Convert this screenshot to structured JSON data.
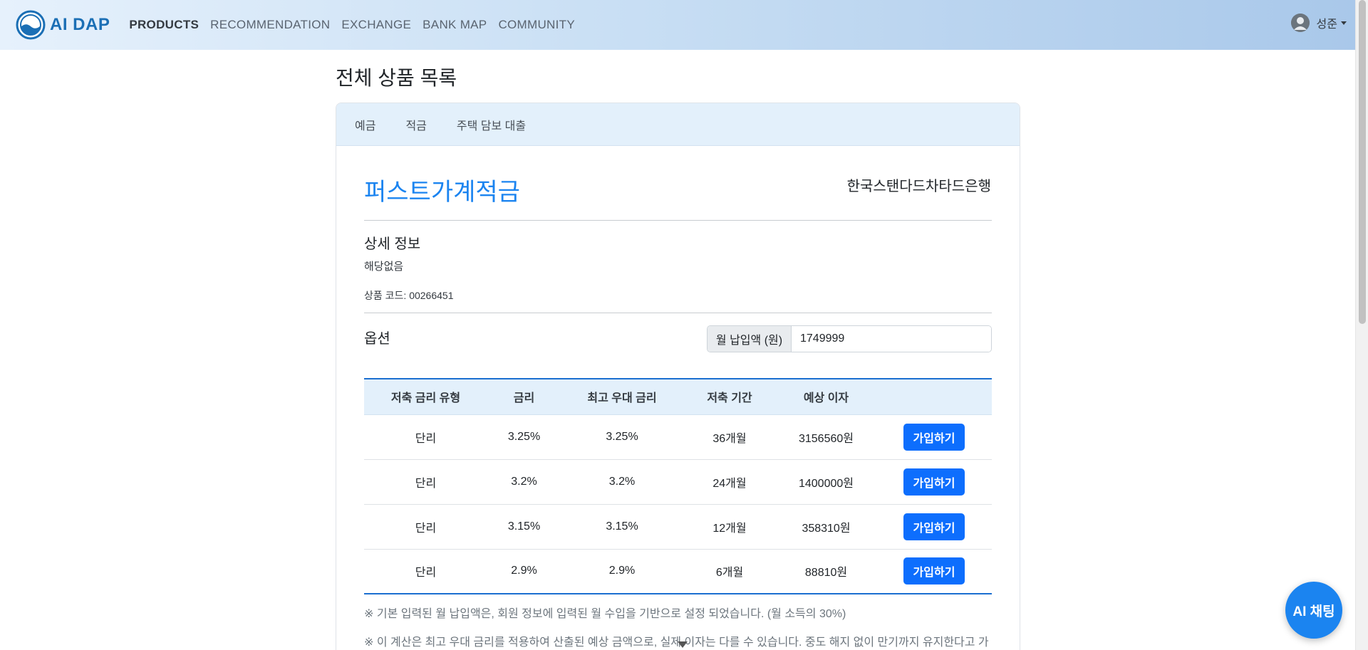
{
  "navbar": {
    "brand": "AI DAP",
    "links": [
      {
        "label": "PRODUCTS",
        "active": true
      },
      {
        "label": "RECOMMENDATION",
        "active": false
      },
      {
        "label": "EXCHANGE",
        "active": false
      },
      {
        "label": "BANK MAP",
        "active": false
      },
      {
        "label": "COMMUNITY",
        "active": false
      }
    ],
    "user_name": "성준"
  },
  "page": {
    "title": "전체 상품 목록",
    "tabs": [
      "예금",
      "적금",
      "주택 담보 대출"
    ]
  },
  "product": {
    "name": "퍼스트가계적금",
    "bank": "한국스탠다드차타드은행",
    "detail_title": "상세 정보",
    "detail_text": "해당없음",
    "code_label": "상품 코드: 00266451"
  },
  "options": {
    "title": "옵션",
    "monthly_label": "월 납입액 (원)",
    "monthly_value": "1749999"
  },
  "table": {
    "headers": [
      "저축 금리 유형",
      "금리",
      "최고 우대 금리",
      "저축 기간",
      "예상 이자",
      ""
    ],
    "rows": [
      {
        "type": "단리",
        "rate": "3.25%",
        "max_rate": "3.25%",
        "period": "36개월",
        "interest": "3156560원",
        "button": "가입하기"
      },
      {
        "type": "단리",
        "rate": "3.2%",
        "max_rate": "3.2%",
        "period": "24개월",
        "interest": "1400000원",
        "button": "가입하기"
      },
      {
        "type": "단리",
        "rate": "3.15%",
        "max_rate": "3.15%",
        "period": "12개월",
        "interest": "358310원",
        "button": "가입하기"
      },
      {
        "type": "단리",
        "rate": "2.9%",
        "max_rate": "2.9%",
        "period": "6개월",
        "interest": "88810원",
        "button": "가입하기"
      }
    ]
  },
  "notes": [
    "※ 기본 입력된 월 납입액은, 회원 정보에 입력된 월 수입을 기반으로 설정 되었습니다. (월 소득의 30%)",
    "※ 이 계산은 최고 우대 금리를 적용하여 산출된 예상 금액으로, 실제 이자는 다를 수 있습니다. 중도 해지 없이 만기까지 유지한다고 가"
  ],
  "ai_chat_label": "AI 채팅",
  "colors": {
    "brand": "#1b6fb5",
    "accent": "#1b84f0",
    "button": "#0d6efd"
  }
}
